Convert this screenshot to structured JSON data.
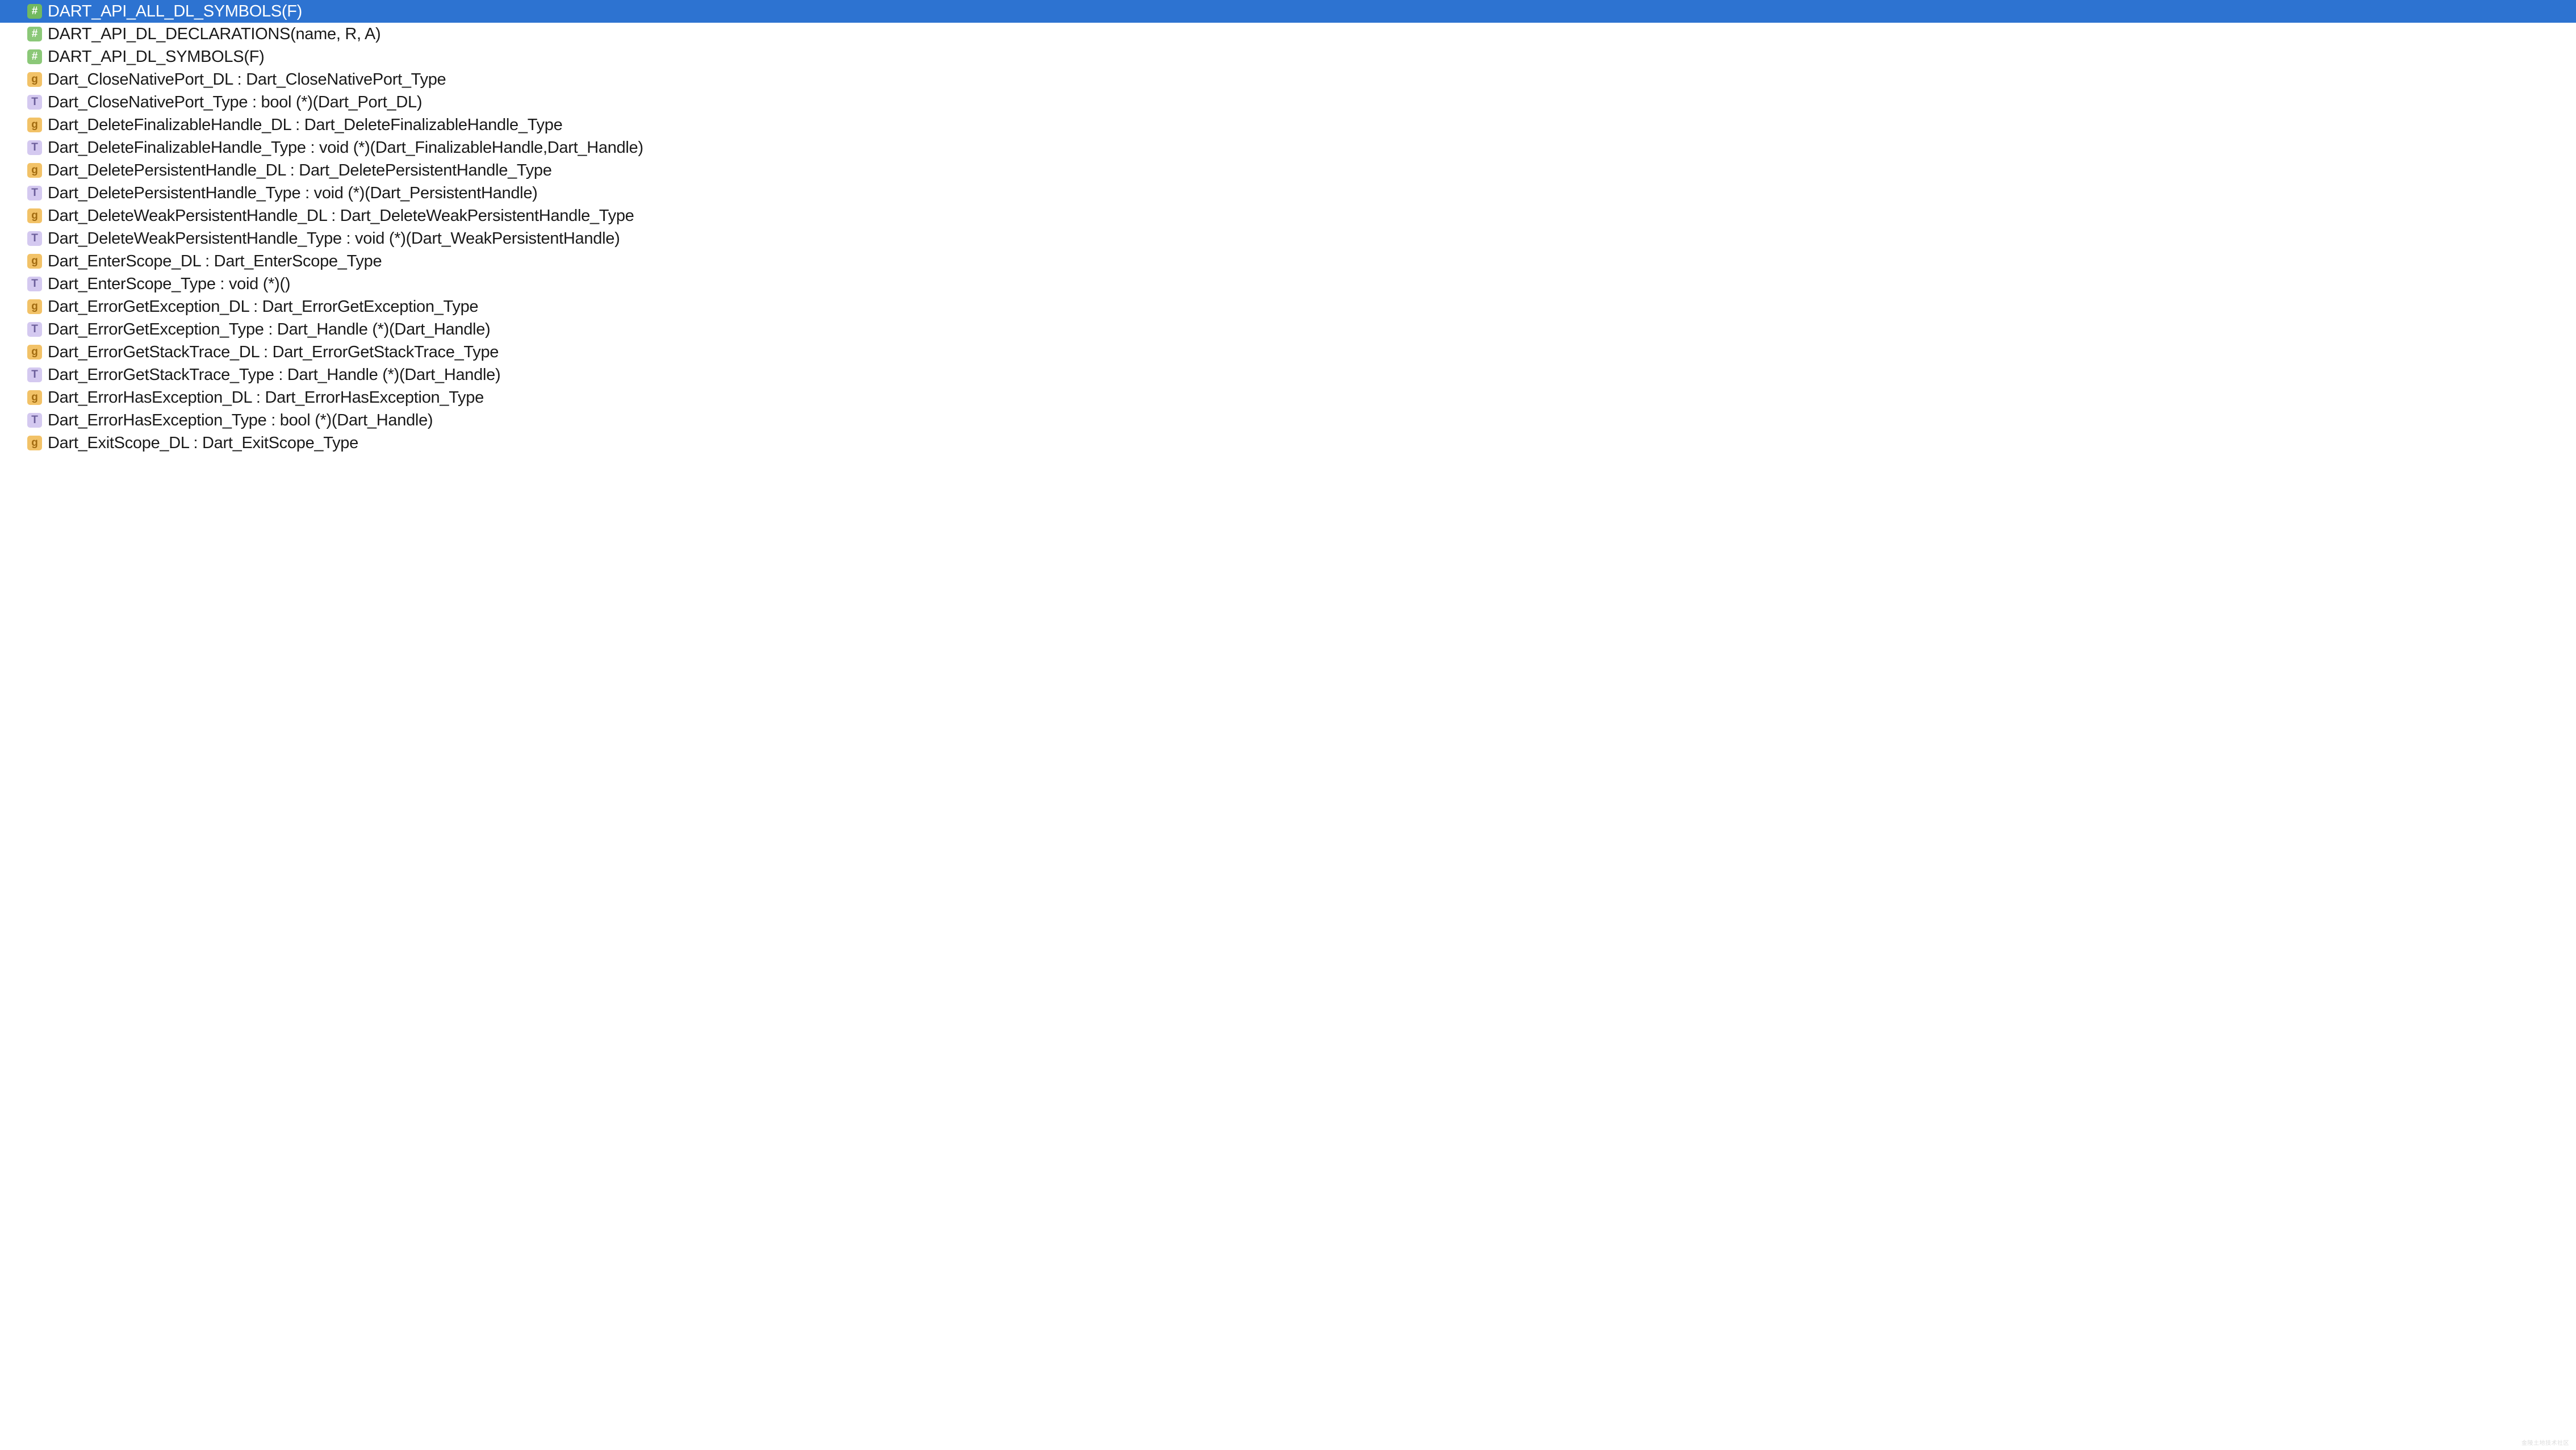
{
  "symbols": [
    {
      "kind": "macro",
      "label": "DART_API_ALL_DL_SYMBOLS(F)",
      "selected": true
    },
    {
      "kind": "macro",
      "label": "DART_API_DL_DECLARATIONS(name, R, A)",
      "selected": false
    },
    {
      "kind": "macro",
      "label": "DART_API_DL_SYMBOLS(F)",
      "selected": false
    },
    {
      "kind": "global",
      "label": "Dart_CloseNativePort_DL : Dart_CloseNativePort_Type",
      "selected": false
    },
    {
      "kind": "type",
      "label": "Dart_CloseNativePort_Type : bool (*)(Dart_Port_DL)",
      "selected": false
    },
    {
      "kind": "global",
      "label": "Dart_DeleteFinalizableHandle_DL : Dart_DeleteFinalizableHandle_Type",
      "selected": false
    },
    {
      "kind": "type",
      "label": "Dart_DeleteFinalizableHandle_Type : void (*)(Dart_FinalizableHandle,Dart_Handle)",
      "selected": false
    },
    {
      "kind": "global",
      "label": "Dart_DeletePersistentHandle_DL : Dart_DeletePersistentHandle_Type",
      "selected": false
    },
    {
      "kind": "type",
      "label": "Dart_DeletePersistentHandle_Type : void (*)(Dart_PersistentHandle)",
      "selected": false
    },
    {
      "kind": "global",
      "label": "Dart_DeleteWeakPersistentHandle_DL : Dart_DeleteWeakPersistentHandle_Type",
      "selected": false
    },
    {
      "kind": "type",
      "label": "Dart_DeleteWeakPersistentHandle_Type : void (*)(Dart_WeakPersistentHandle)",
      "selected": false
    },
    {
      "kind": "global",
      "label": "Dart_EnterScope_DL : Dart_EnterScope_Type",
      "selected": false
    },
    {
      "kind": "type",
      "label": "Dart_EnterScope_Type : void (*)()",
      "selected": false
    },
    {
      "kind": "global",
      "label": "Dart_ErrorGetException_DL : Dart_ErrorGetException_Type",
      "selected": false
    },
    {
      "kind": "type",
      "label": "Dart_ErrorGetException_Type : Dart_Handle (*)(Dart_Handle)",
      "selected": false
    },
    {
      "kind": "global",
      "label": "Dart_ErrorGetStackTrace_DL : Dart_ErrorGetStackTrace_Type",
      "selected": false
    },
    {
      "kind": "type",
      "label": "Dart_ErrorGetStackTrace_Type : Dart_Handle (*)(Dart_Handle)",
      "selected": false
    },
    {
      "kind": "global",
      "label": "Dart_ErrorHasException_DL : Dart_ErrorHasException_Type",
      "selected": false
    },
    {
      "kind": "type",
      "label": "Dart_ErrorHasException_Type : bool (*)(Dart_Handle)",
      "selected": false
    },
    {
      "kind": "global",
      "label": "Dart_ExitScope_DL : Dart_ExitScope_Type",
      "selected": false
    }
  ],
  "icon_chars": {
    "macro": "#",
    "global": "g",
    "type": "T"
  },
  "watermark": "金陵土地技术社区"
}
